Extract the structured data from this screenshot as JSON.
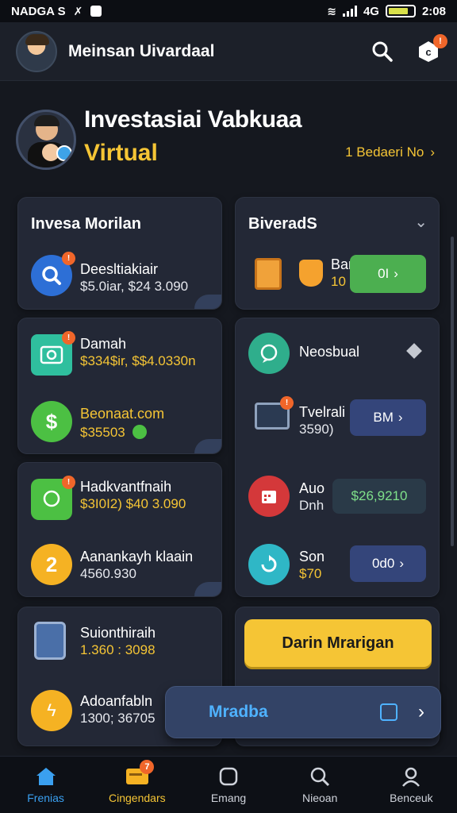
{
  "status": {
    "left": "NADGA S",
    "right": "4G",
    "time": "2:08",
    "battery_pct": 80
  },
  "appbar": {
    "title": "Meinsan Uivardaal"
  },
  "hero": {
    "title": "Investasiai Vabkuaa",
    "subtitle": "Virtual",
    "link": "1  Bedaeri No"
  },
  "cards": {
    "left1": {
      "title": "Invesa Morilan",
      "rows": [
        {
          "title": "Deesltiakiair",
          "sub": "$5.0iar, $24 3.090"
        }
      ]
    },
    "right1": {
      "title": "BiveradS",
      "rows": [
        {
          "title": "Barama",
          "sub": "10",
          "btn": "0I"
        }
      ]
    },
    "left2": {
      "rows": [
        {
          "title": "Damah",
          "sub": "$334$ir, $$4.0330n"
        },
        {
          "title": "Beonaat.com",
          "sub": "$35503"
        }
      ]
    },
    "right2": {
      "title": "Neosbual",
      "rows": [
        {
          "title": "Tvelrali",
          "sub": "3590)",
          "btn": "BM"
        },
        {
          "title": "Auo",
          "sub": "Dnh",
          "btn": "$26,9210"
        },
        {
          "title": "Son",
          "sub": "$70",
          "btn": "0d0"
        }
      ]
    },
    "left3": {
      "rows": [
        {
          "title": "Hadkvantfnaih",
          "sub": "$3I0I2) $40 3.090"
        },
        {
          "title": "Aanankayh klaain",
          "sub": "4560.930"
        }
      ]
    },
    "left4": {
      "rows": [
        {
          "title": "Suionthiraih",
          "sub": "1.360 : 3098"
        },
        {
          "title": "Adoanfabln",
          "sub": "1300; 36705"
        }
      ]
    }
  },
  "cta": {
    "label": "Darin Mrarigan"
  },
  "floating": {
    "label": "Mradba"
  },
  "tabs": [
    {
      "label": "Frenias",
      "active": true
    },
    {
      "label": "Cingendars",
      "badge": "7"
    },
    {
      "label": "Emang"
    },
    {
      "label": "Nieoan"
    },
    {
      "label": "Benceuk"
    }
  ]
}
